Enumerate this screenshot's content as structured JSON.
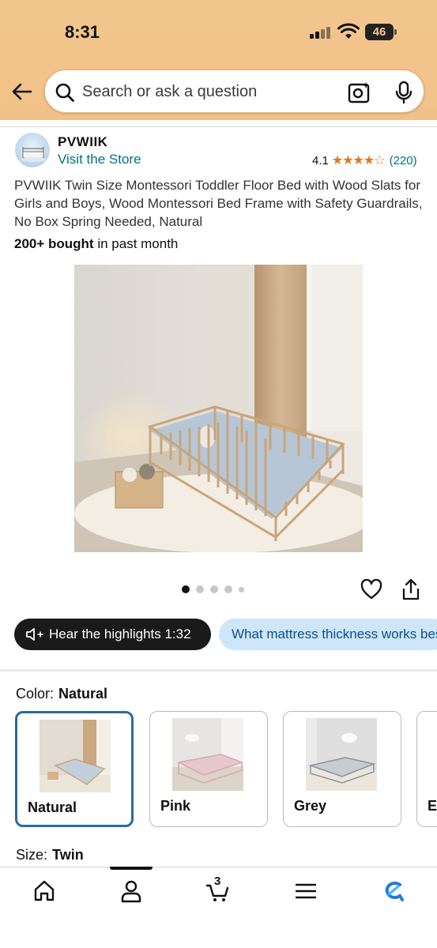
{
  "status_bar": {
    "time": "8:31",
    "battery": "46",
    "battery_level": 0.46
  },
  "search": {
    "placeholder": "Search or ask a question"
  },
  "brand": {
    "name": "PVWIIK",
    "visit_store": "Visit the Store"
  },
  "rating": {
    "value": "4.1",
    "stars": 4.1,
    "count": "(220)"
  },
  "product": {
    "title": "PVWIIK Twin Size Montessori Toddler Floor Bed with Wood Slats for Girls and Boys, Wood Montessori Bed Frame with Safety Guardrails, No Box Spring Needed, Natural",
    "bought_bold": "200+ bought",
    "bought_rest": " in past month",
    "image_count": 5,
    "image_index": 1
  },
  "highlights": {
    "label": "Hear the highlights 1:32"
  },
  "question_chip": {
    "label": "What mattress thickness works best?"
  },
  "color": {
    "label": "Color:",
    "selected": "Natural"
  },
  "swatches": [
    {
      "label": "Natural",
      "selected": true
    },
    {
      "label": "Pink",
      "selected": false
    },
    {
      "label": "Grey",
      "selected": false
    },
    {
      "label": "E",
      "selected": false
    }
  ],
  "size": {
    "label": "Size:",
    "selected": "Twin"
  },
  "bottom_nav": {
    "cart_count": "3",
    "active": "account"
  },
  "colors": {
    "link": "#007185",
    "star": "#de7921",
    "selected_border": "#2a6aa1",
    "header_bg": "#f3c68f"
  }
}
